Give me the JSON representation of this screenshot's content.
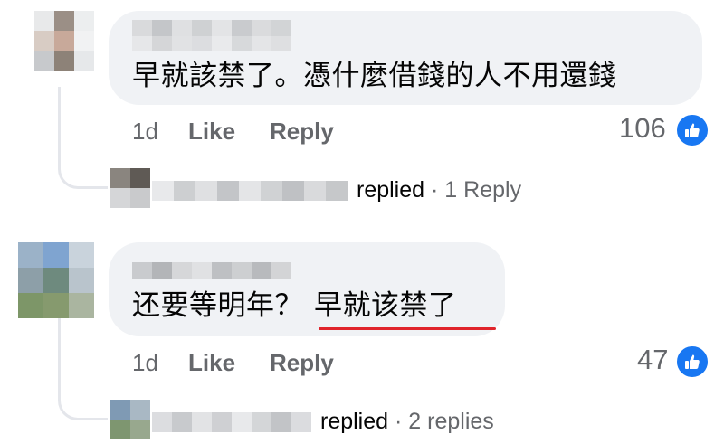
{
  "comments": [
    {
      "text": "早就該禁了。憑什麼借錢的人不用還錢",
      "time": "1d",
      "like_label": "Like",
      "reply_label": "Reply",
      "reaction_count": "106",
      "reaction_icon": "thumbs-up-icon",
      "replies": {
        "replied_word": "replied",
        "separator": "·",
        "count_label": "1 Reply"
      }
    },
    {
      "text_before_highlight": "还要等明年？",
      "highlight_text": "早就该禁了",
      "time": "1d",
      "like_label": "Like",
      "reply_label": "Reply",
      "reaction_count": "47",
      "reaction_icon": "thumbs-up-icon",
      "highlight_color": "#e0242b",
      "replies": {
        "replied_word": "replied",
        "separator": "·",
        "count_label": "2 replies"
      }
    }
  ],
  "colors": {
    "bubble_bg": "#f0f2f5",
    "muted_text": "#65676b",
    "like_blue": "#1877f2",
    "thread_line": "#e4e6eb"
  }
}
